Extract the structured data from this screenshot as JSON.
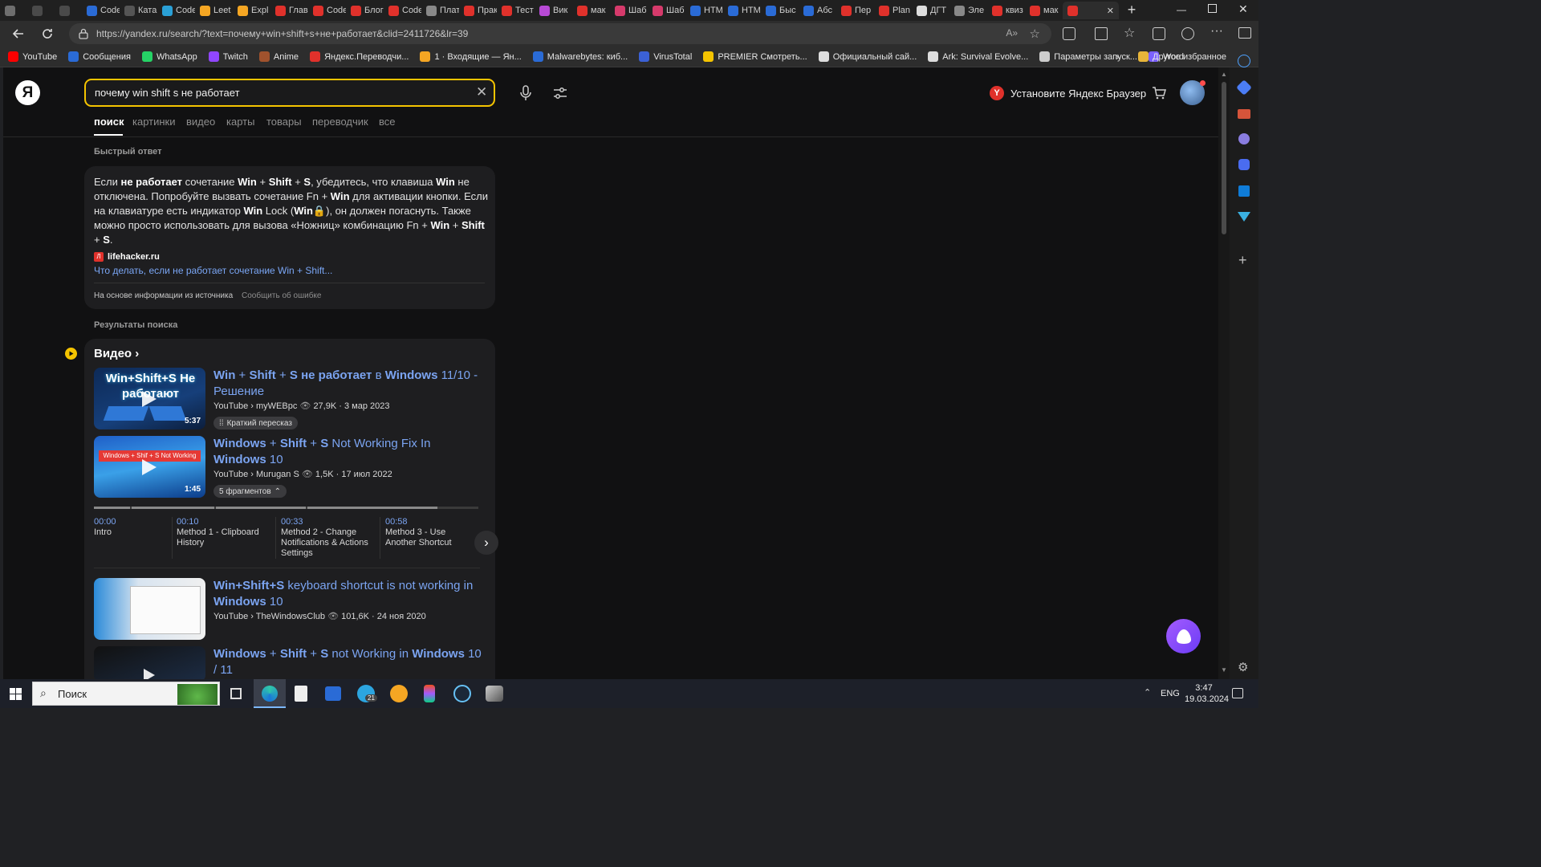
{
  "tabs": [
    {
      "label": "",
      "color": "#6e6e6e"
    },
    {
      "label": "",
      "color": "#4a4a4a"
    },
    {
      "label": "",
      "color": "#4a4a4a"
    },
    {
      "label": "Code",
      "color": "#2a6bd6"
    },
    {
      "label": "Ката",
      "color": "#555"
    },
    {
      "label": "Code",
      "color": "#2aa0d6"
    },
    {
      "label": "Leet",
      "color": "#f5a623"
    },
    {
      "label": "Expl",
      "color": "#f5a623"
    },
    {
      "label": "Глав",
      "color": "#e0312b"
    },
    {
      "label": "Code",
      "color": "#e0312b"
    },
    {
      "label": "Блог",
      "color": "#e0312b"
    },
    {
      "label": "Code",
      "color": "#e0312b"
    },
    {
      "label": "Плат",
      "color": "#888"
    },
    {
      "label": "Прак",
      "color": "#e0312b"
    },
    {
      "label": "Тест",
      "color": "#e0312b"
    },
    {
      "label": "Вик",
      "color": "#b84ad6"
    },
    {
      "label": "мак",
      "color": "#e0312b"
    },
    {
      "label": "Шаб",
      "color": "#d63a6b"
    },
    {
      "label": "Шаб",
      "color": "#d63a6b"
    },
    {
      "label": "HTM",
      "color": "#2a6bd6"
    },
    {
      "label": "HTM",
      "color": "#2a6bd6"
    },
    {
      "label": "Быс",
      "color": "#2a6bd6"
    },
    {
      "label": "Абс",
      "color": "#2a6bd6"
    },
    {
      "label": "Пер",
      "color": "#e0312b"
    },
    {
      "label": "Plan",
      "color": "#e0312b"
    },
    {
      "label": "ДГТ",
      "color": "#ddd"
    },
    {
      "label": "Эле",
      "color": "#888"
    },
    {
      "label": "квиз",
      "color": "#e0312b"
    },
    {
      "label": "мак",
      "color": "#e0312b"
    }
  ],
  "active_tab": {
    "label": "",
    "close": "✕"
  },
  "new_tab": "+",
  "url": "https://yandex.ru/search/?text=почему+win+shift+s+не+работает&clid=2411726&lr=39",
  "bookmarks": [
    {
      "label": "YouTube",
      "color": "#ff0000"
    },
    {
      "label": "Сообщения",
      "color": "#2a6bd6"
    },
    {
      "label": "WhatsApp",
      "color": "#25d366"
    },
    {
      "label": "Twitch",
      "color": "#9146ff"
    },
    {
      "label": "Anime",
      "color": "#a0522d"
    },
    {
      "label": "Яндекс.Переводчи...",
      "color": "#e0312b"
    },
    {
      "label": "1 · Входящие — Ян...",
      "color": "#f5a623"
    },
    {
      "label": "Malwarebytes: киб...",
      "color": "#2a6bd6"
    },
    {
      "label": "VirusTotal",
      "color": "#3b61d6"
    },
    {
      "label": "PREMIER Смотреть...",
      "color": "#f5c400"
    },
    {
      "label": "Официальный сай...",
      "color": "#ddd"
    },
    {
      "label": "Ark: Survival Evolve...",
      "color": "#ddd"
    },
    {
      "label": "Параметры запуск...",
      "color": "#ccc"
    },
    {
      "label": "Word",
      "color": "#7b61ff"
    }
  ],
  "bookmarks_more": "Другое избранное",
  "search": {
    "query": "почему win shift s не работает"
  },
  "promo": "Установите Яндекс Браузер",
  "nav_tabs": [
    "поиск",
    "картинки",
    "видео",
    "карты",
    "товары",
    "переводчик",
    "все"
  ],
  "quick_answer": {
    "heading": "Быстрый ответ",
    "source": "lifehacker.ru",
    "link": "Что делать, если не работает сочетание Win + Shift...",
    "footer_left": "На основе информации из источника",
    "footer_right": "Сообщить об ошибке"
  },
  "results_heading": "Результаты поиска",
  "video_section": "Видео",
  "videos": [
    {
      "title": "Win + Shift + S не работает в Windows 11/10 - Решение",
      "meta": "YouTube › myWEBpc",
      "views": "27,9K",
      "date": "3 мар 2023",
      "duration": "5:37",
      "chip": "Краткий пересказ",
      "thumb_text": "Win+Shift+S Не работают"
    },
    {
      "title": "Windows + Shift + S Not Working Fix In Windows 10",
      "meta": "YouTube › Murugan S",
      "views": "1,5K",
      "date": "17 июл 2022",
      "duration": "1:45",
      "chip": "5 фрагментов",
      "thumb_text": "Windows + Shif + S Not Working Fix In Windows 10"
    },
    {
      "title": "Win+Shift+S keyboard shortcut is not working in Windows 10",
      "meta": "YouTube › TheWindowsClub",
      "views": "101,6K",
      "date": "24 ноя 2020"
    },
    {
      "title": "Windows + Shift + S not Working in Windows 10 / 11"
    }
  ],
  "timeline": [
    {
      "time": "00:00",
      "label": "Intro"
    },
    {
      "time": "00:10",
      "label": "Method 1 - Clipboard History"
    },
    {
      "time": "00:33",
      "label": "Method 2 - Change Notifications & Actions Settings"
    },
    {
      "time": "00:58",
      "label": "Method 3 - Use Another Shortcut"
    }
  ],
  "taskbar": {
    "search": "Поиск",
    "lang": "ENG",
    "time": "3:47",
    "date": "19.03.2024",
    "badge": "21"
  }
}
